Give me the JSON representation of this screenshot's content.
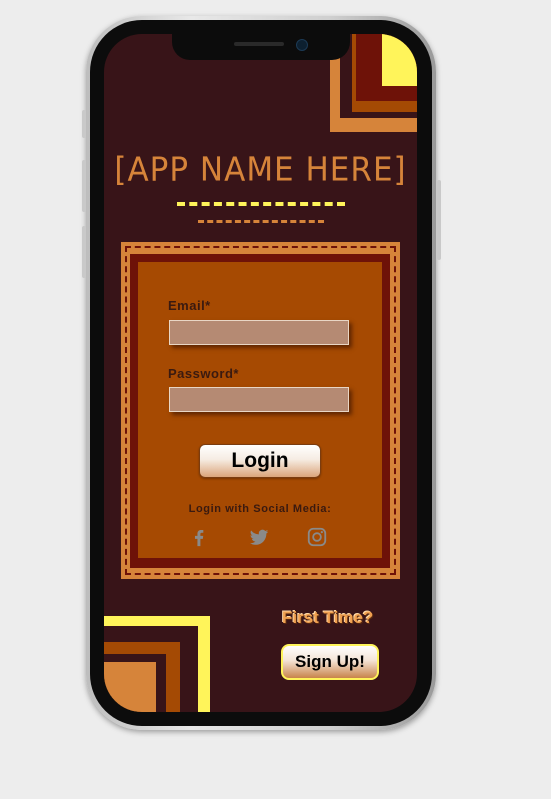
{
  "app": {
    "title": "[APP NAME HERE]"
  },
  "form": {
    "email_label": "Email*",
    "email_value": "",
    "password_label": "Password*",
    "password_value": "",
    "login_label": "Login"
  },
  "social": {
    "label": "Login with Social Media:",
    "icons": [
      "facebook-icon",
      "twitter-icon",
      "instagram-icon"
    ]
  },
  "signup": {
    "prompt": "First Time?",
    "button_label": "Sign Up!"
  },
  "colors": {
    "background": "#381418",
    "accent_orange": "#d6843a",
    "accent_yellow": "#fff45a",
    "card": "#a64a02",
    "card_border": "#6e1208"
  }
}
